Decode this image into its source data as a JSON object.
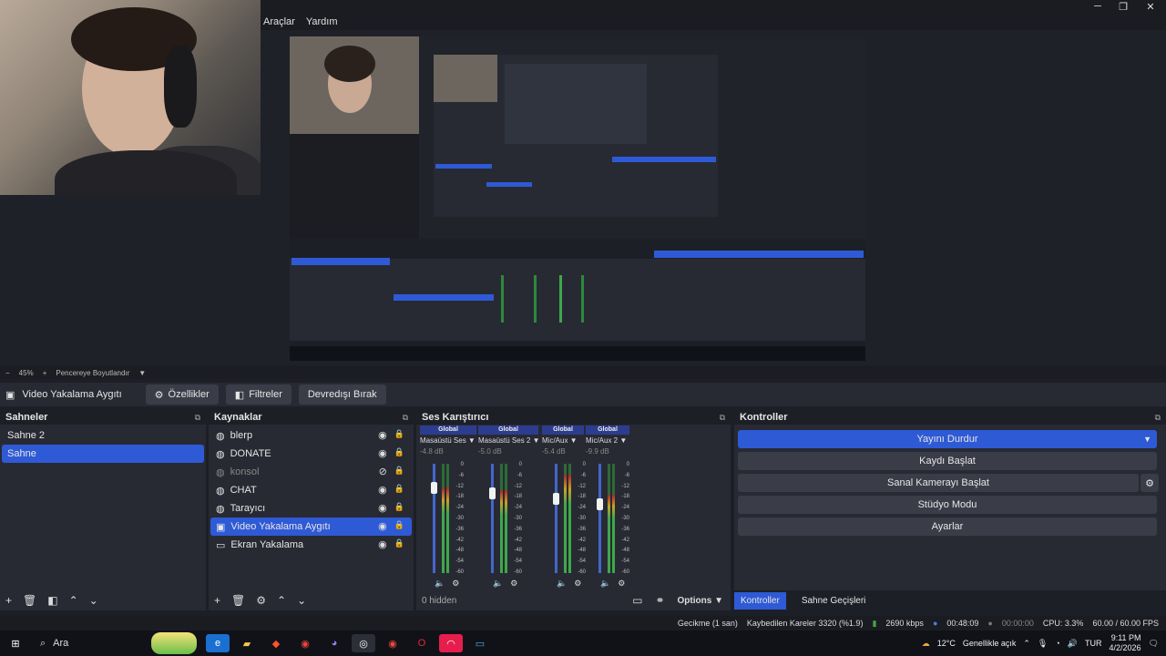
{
  "menu": {
    "tools": "Araçlar",
    "help": "Yardım"
  },
  "window": {
    "minimize": "─",
    "restore": "❐",
    "close": "✕"
  },
  "zoom": {
    "minus": "−",
    "value": "45%",
    "plus": "+",
    "mode": "Pencereye Boyutlandır",
    "chevron": "▼"
  },
  "source_toolbar": {
    "source_name": "Video Yakalama Aygıtı",
    "properties": "Özellikler",
    "filters": "Filtreler",
    "deactivate": "Devredışı Bırak"
  },
  "scenes": {
    "title": "Sahneler",
    "items": [
      "Sahne 2",
      "Sahne"
    ],
    "selected": 1
  },
  "sources": {
    "title": "Kaynaklar",
    "items": [
      {
        "label": "blerp",
        "icon": "globe-icon",
        "visible": true
      },
      {
        "label": "DONATE",
        "icon": "globe-icon",
        "visible": true
      },
      {
        "label": "konsol",
        "icon": "globe-icon",
        "visible": false
      },
      {
        "label": "CHAT",
        "icon": "globe-icon",
        "visible": true
      },
      {
        "label": "Tarayıcı",
        "icon": "globe-icon",
        "visible": true
      },
      {
        "label": "Video Yakalama Aygıtı",
        "icon": "camera-icon",
        "visible": true
      },
      {
        "label": "Ekran Yakalama",
        "icon": "monitor-icon",
        "visible": true
      }
    ],
    "selected": 5
  },
  "mixer": {
    "title": "Ses Karıştırıcı",
    "channels": [
      {
        "global": "Global",
        "name": "Masaüstü Ses",
        "db": "-4.8 dB",
        "level": 0.78
      },
      {
        "global": "Global",
        "name": "Masaüstü Ses 2",
        "db": "-5.0 dB",
        "level": 0.76
      },
      {
        "global": "Global",
        "name": "Mic/Aux",
        "db": "-5.4 dB",
        "level": 0.9
      },
      {
        "global": "Global",
        "name": "Mic/Aux 2",
        "db": "-9.9 dB",
        "level": 0.72
      }
    ],
    "scale": [
      "0",
      "-6",
      "-12",
      "-18",
      "-24",
      "-30",
      "-36",
      "-42",
      "-48",
      "-54",
      "-60"
    ],
    "hidden": "0 hidden",
    "options": "Options"
  },
  "controls": {
    "title": "Kontroller",
    "buttons": [
      "Yayını Durdur",
      "Kaydı Başlat",
      "Sanal Kamerayı Başlat",
      "Stüdyo Modu",
      "Ayarlar"
    ],
    "tabs": [
      "Kontroller",
      "Sahne Geçişleri"
    ]
  },
  "status": {
    "delay": "Gecikme (1 san)",
    "dropped": "Kaybedilen Kareler 3320 (%1.9)",
    "bitrate": "2690 kbps",
    "stream_time": "00:48:09",
    "rec_time": "00:00:00",
    "cpu": "CPU: 3.3%",
    "fps": "60.00 / 60.00 FPS"
  },
  "taskbar": {
    "search": "Ara",
    "weather": "12°C",
    "weather_desc": "Genellikle açık",
    "lang": "TUR",
    "time": "9:11 PM",
    "date": "4/2/2026"
  },
  "colors": {
    "accent": "#2f5ad6",
    "panel": "#272a33",
    "background": "#1d1f26"
  }
}
